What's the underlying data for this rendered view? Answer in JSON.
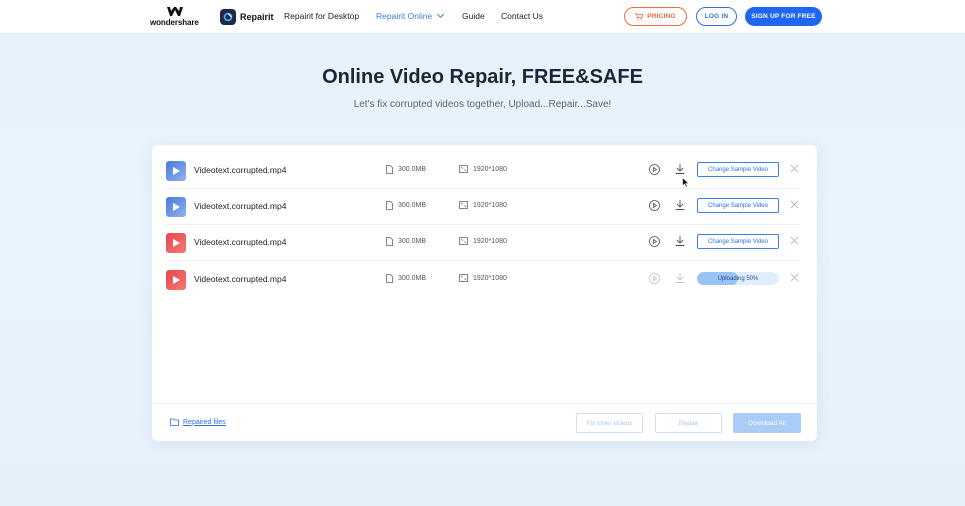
{
  "nav": {
    "brand": "wondershare",
    "product": "Repairit",
    "links": [
      "Repairit for Desktop",
      "Repairit Online",
      "Guide",
      "Contact Us"
    ],
    "pricing": "PRICING",
    "login": "LOG IN",
    "signup": "SIGN UP FOR FREE"
  },
  "hero": {
    "title": "Online Video Repair, FREE&SAFE",
    "subtitle": "Let's fix corrupted videos together, Upload...Repair...Save!"
  },
  "files": [
    {
      "name": "Videotext.corrupted.mp4",
      "size": "300.0MB",
      "resolution": "1920*1080",
      "action": "Change Sample Video",
      "thumb": "blue"
    },
    {
      "name": "Videotext.corrupted.mp4",
      "size": "300.0MB",
      "resolution": "1920*1080",
      "action": "Change Sample Video",
      "thumb": "blue"
    },
    {
      "name": "Videotext.corrupted.mp4",
      "size": "300.0MB",
      "resolution": "1920*1080",
      "action": "Change Sample Video",
      "thumb": "red"
    },
    {
      "name": "Videotext.corrupted.mp4",
      "size": "300.0MB",
      "resolution": "1920*1080",
      "action": "Uploading 50%",
      "progress": 0.5,
      "thumb": "red"
    }
  ],
  "footer": {
    "repaired_files": "Repaired files",
    "fix_other": "Fix other videos",
    "repair": "Repair",
    "download_all": "Download All"
  },
  "colors": {
    "accent": "#1f66f0",
    "pricing": "#f06a3e",
    "link_active": "#3d7fe0"
  },
  "icons": [
    "wondershare-logo-icon",
    "repairit-app-icon",
    "cart-icon",
    "file-icon",
    "resolution-icon",
    "play-icon",
    "download-icon",
    "close-icon",
    "folder-icon",
    "cursor-icon"
  ]
}
